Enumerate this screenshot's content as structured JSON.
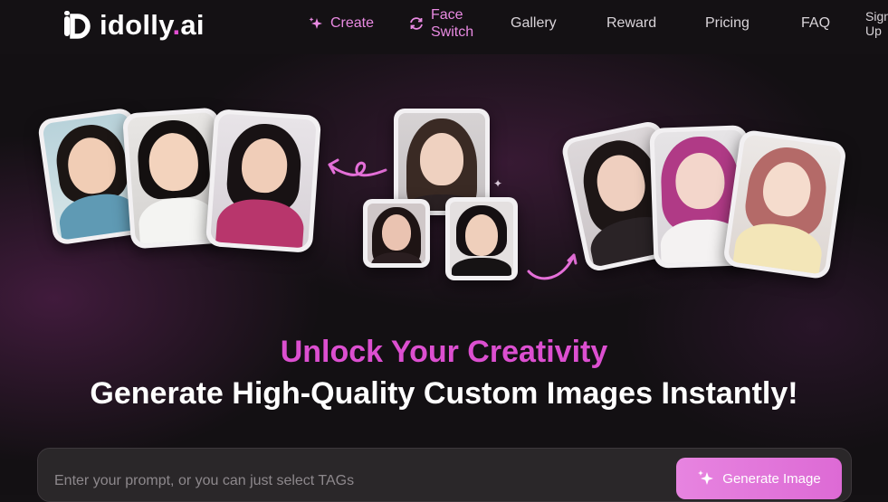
{
  "brand": {
    "name_main": "idolly",
    "name_dot": ".",
    "name_tld": "ai"
  },
  "nav": {
    "create": "Create",
    "face_switch_line1": "Face",
    "face_switch_line2": "Switch",
    "gallery": "Gallery",
    "reward": "Reward",
    "pricing": "Pricing",
    "faq": "FAQ",
    "signup_line1": "Sign",
    "signup_line2": "Up"
  },
  "hero": {
    "headline": "Unlock Your Creativity",
    "subheadline": "Generate High-Quality Custom Images Instantly!"
  },
  "prompt": {
    "placeholder": "Enter your prompt, or you can just select TAGs",
    "value": "",
    "generate_label": "Generate Image"
  },
  "colors": {
    "accent": "#dc4fd0",
    "background": "#141114",
    "button": "#e47cdd"
  },
  "icons": [
    "logo-icon",
    "sparkle-icon",
    "swap-icon",
    "curved-arrow-left-icon",
    "curved-arrow-right-icon"
  ]
}
